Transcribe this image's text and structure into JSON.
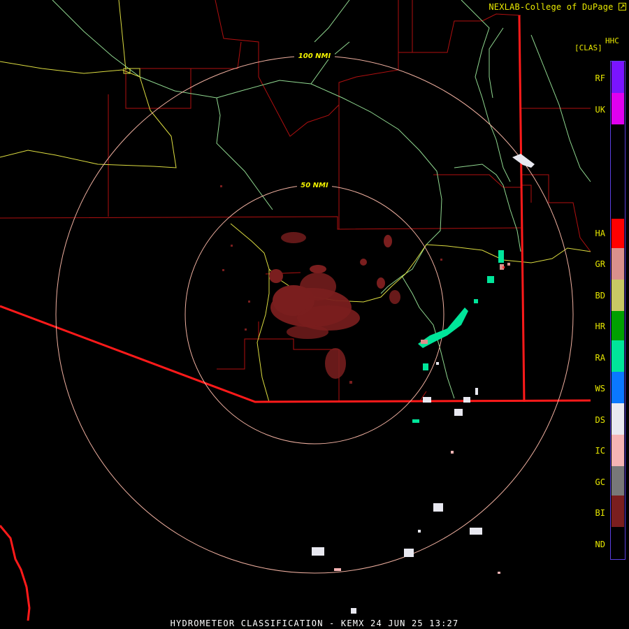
{
  "header": {
    "credit": "NEXLAB-College of DuPage",
    "credit_icon": "external-link-icon",
    "product_code": "HHC",
    "product_subcode": "[CLAS]"
  },
  "range_rings": [
    {
      "label": "50 NMI"
    },
    {
      "label": "100 NMI"
    }
  ],
  "legend": {
    "items": [
      {
        "code": "RF",
        "color": "#7a14ff"
      },
      {
        "code": "UK",
        "color": "#e000f0"
      },
      {
        "code": "HA",
        "color": "#ff0000"
      },
      {
        "code": "GR",
        "color": "#d9908c"
      },
      {
        "code": "BD",
        "color": "#c8c864"
      },
      {
        "code": "HR",
        "color": "#00a000"
      },
      {
        "code": "RA",
        "color": "#00e59a"
      },
      {
        "code": "WS",
        "color": "#0a78ff"
      },
      {
        "code": "DS",
        "color": "#e8e8f0"
      },
      {
        "code": "IC",
        "color": "#f5b4b4"
      },
      {
        "code": "GC",
        "color": "#787878"
      },
      {
        "code": "BI",
        "color": "#7a1e1e"
      },
      {
        "code": "ND",
        "color": "#000000"
      }
    ]
  },
  "footer": {
    "title": "HYDROMETEOR CLASSIFICATION - KEMX 24 JUN 25 13:27"
  },
  "colors": {
    "state_border": "#ff1a1a",
    "county_line": "#b01010",
    "highway": "#dcdc40",
    "river": "#90d890",
    "range_ring": "#f0b0a0"
  }
}
